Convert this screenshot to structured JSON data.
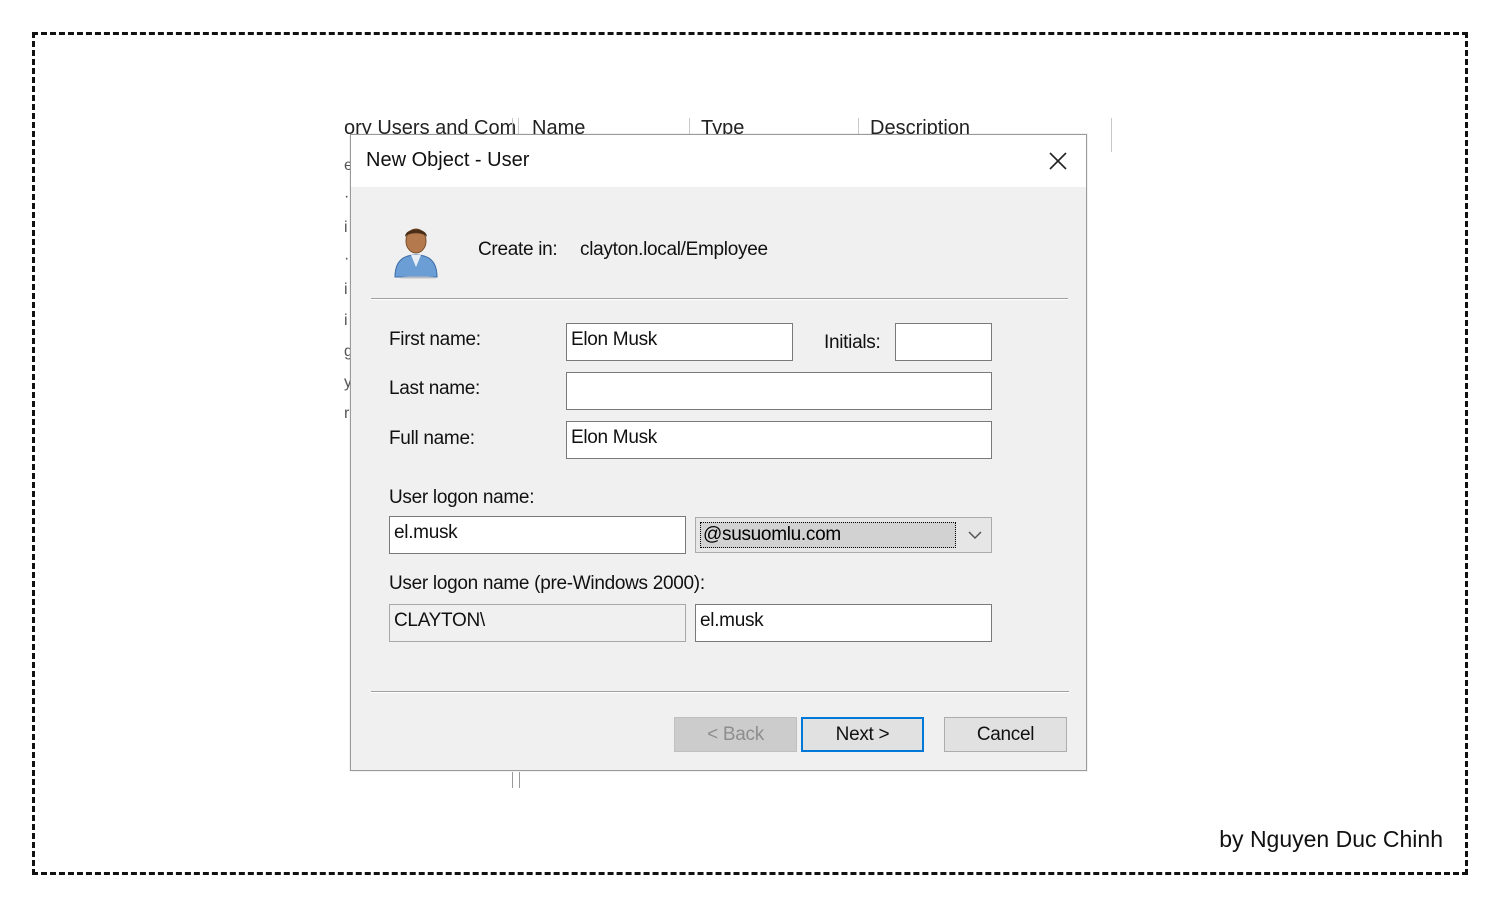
{
  "background_window": {
    "tree_label": "ory Users and Com",
    "columns": [
      "Name",
      "Type",
      "Description"
    ],
    "left_fragment_chars": [
      "e",
      "·",
      "i",
      "·",
      "i",
      "i",
      "g",
      "",
      "y",
      "r"
    ]
  },
  "dialog": {
    "title": "New Object - User",
    "close_label": "✕",
    "icon": "user-icon",
    "create_in_label": "Create in:",
    "create_in_value": "clayton.local/Employee",
    "first_name": {
      "label": "First name:",
      "value": "Elon Musk"
    },
    "initials": {
      "label": "Initials:",
      "value": ""
    },
    "last_name": {
      "label": "Last name:",
      "value": ""
    },
    "full_name": {
      "label": "Full name:",
      "value": "Elon Musk"
    },
    "logon": {
      "label": "User logon name:",
      "value": "el.musk",
      "domain_suffix": "@susuomlu.com"
    },
    "pre_windows": {
      "label": "User logon name (pre-Windows 2000):",
      "domain": "CLAYTON\\",
      "value": "el.musk"
    },
    "buttons": {
      "back": "< Back",
      "next": "Next >",
      "cancel": "Cancel"
    },
    "colors": {
      "accent": "#0078d7",
      "dialog_bg": "#f0f0f0"
    }
  },
  "credit": "by Nguyen Duc Chinh"
}
